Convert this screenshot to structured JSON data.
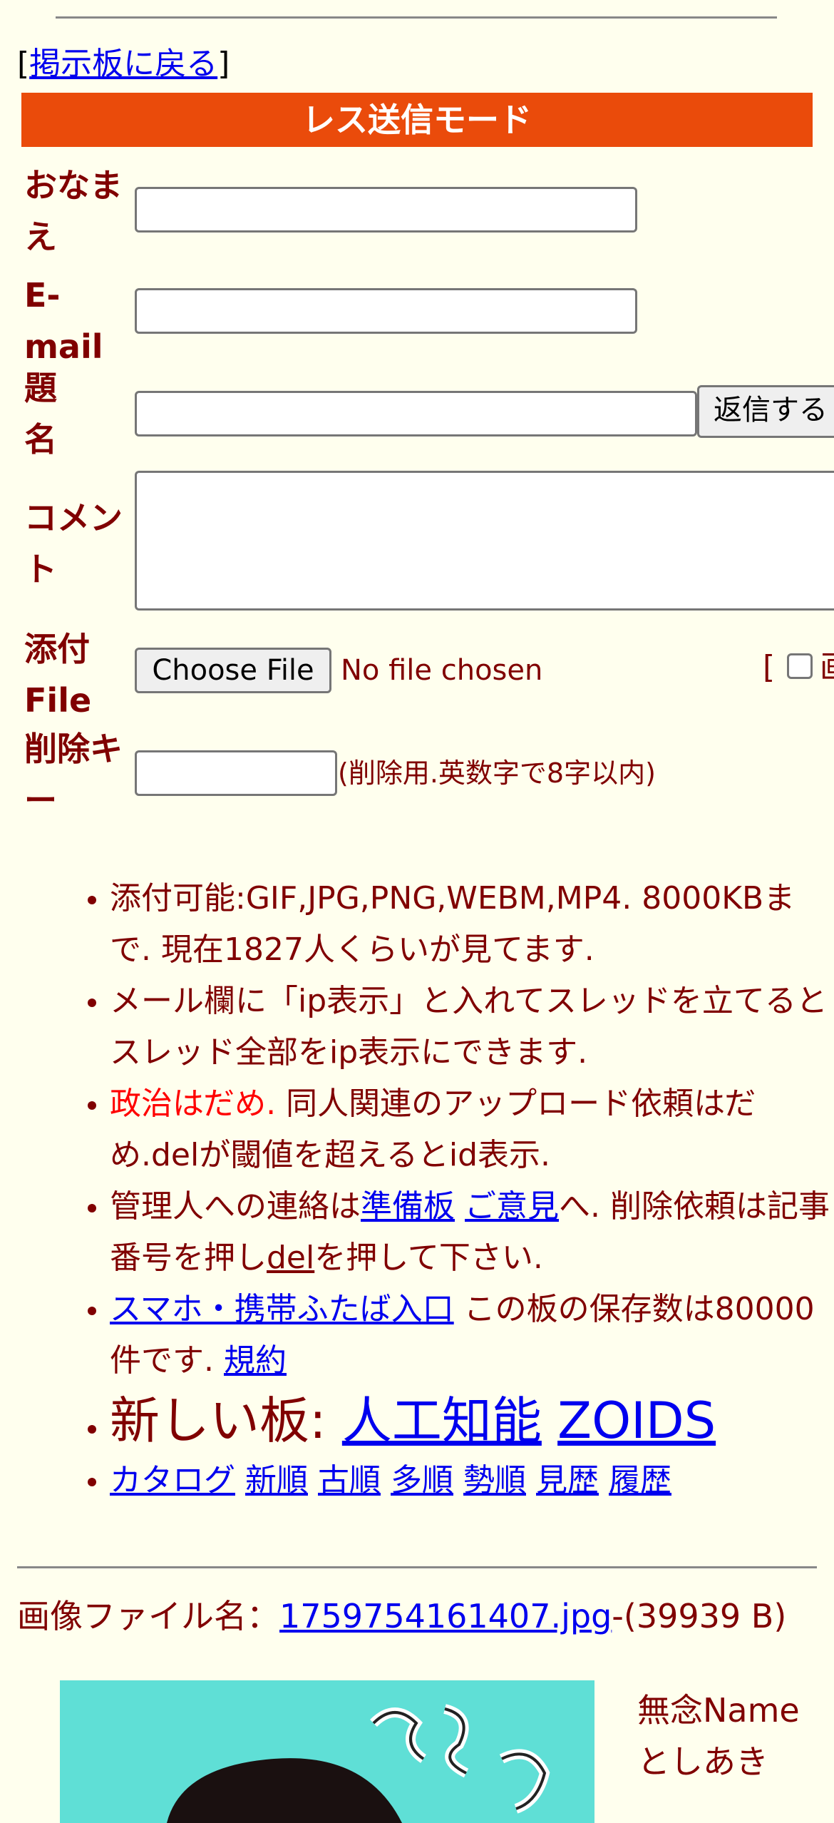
{
  "back": {
    "bracket_open": "[",
    "label": "掲示板に戻る",
    "bracket_close": "]"
  },
  "mode_title": "レス送信モード",
  "form": {
    "name_label_1": "おなま",
    "name_label_2": "え",
    "email_label_1": "E-",
    "email_label_2": "mail",
    "subject_label_1": "題",
    "subject_label_2": "名",
    "submit_label": "返信する",
    "comment_label_1": "コメン",
    "comment_label_2": "ト",
    "file_label_1": "添付",
    "file_label_2": "File",
    "choose_file_label": "Choose File",
    "no_file_text": "No file chosen",
    "image_option_partial": "[",
    "image_option_char": "画",
    "delete_key_label_1": "削除キ",
    "delete_key_label_2": "ー",
    "delete_key_note": "(削除用.英数字で8字以内)"
  },
  "rules": {
    "r1": "添付可能:GIF,JPG,PNG,WEBM,MP4. 8000KBまで. 現在1827人くらいが見てます.",
    "r2": "メール欄に「ip表示」と入れてスレッドを立てるとスレッド全部をip表示にできます.",
    "r3_red": "政治はだめ.",
    "r3_rest": " 同人関連のアップロード依頼はだめ.delが閾値を超えるとid表示.",
    "r4_a": "管理人への連絡は",
    "r4_link1": "準備板",
    "r4_sp": " ",
    "r4_link2": "ご意見",
    "r4_b": "へ. 削除依頼は記事番号を押し",
    "r4_link3": "del",
    "r4_c": "を押して下さい.",
    "r5_link": "スマホ・携帯ふたば入口",
    "r5_text": " この板の保存数は80000件です. ",
    "r5_link2": "規約",
    "r6_text": "新しい板: ",
    "r6_link1": "人工知能",
    "r6_link2": "ZOIDS",
    "nav": [
      "カタログ",
      "新順",
      "古順",
      "多順",
      "勢順",
      "見歴",
      "履歴"
    ]
  },
  "post": {
    "file_label": "画像ファイル名：",
    "file_name": "1759754161407.jpg",
    "file_size": "-(39939 B)",
    "name": "無念Name",
    "poster": "としあき"
  },
  "colors": {
    "accent": "#ea4b0b",
    "text": "#800000",
    "link": "#0000ee",
    "background": "#ffffee",
    "thumbnail": "#5fdfd6"
  }
}
